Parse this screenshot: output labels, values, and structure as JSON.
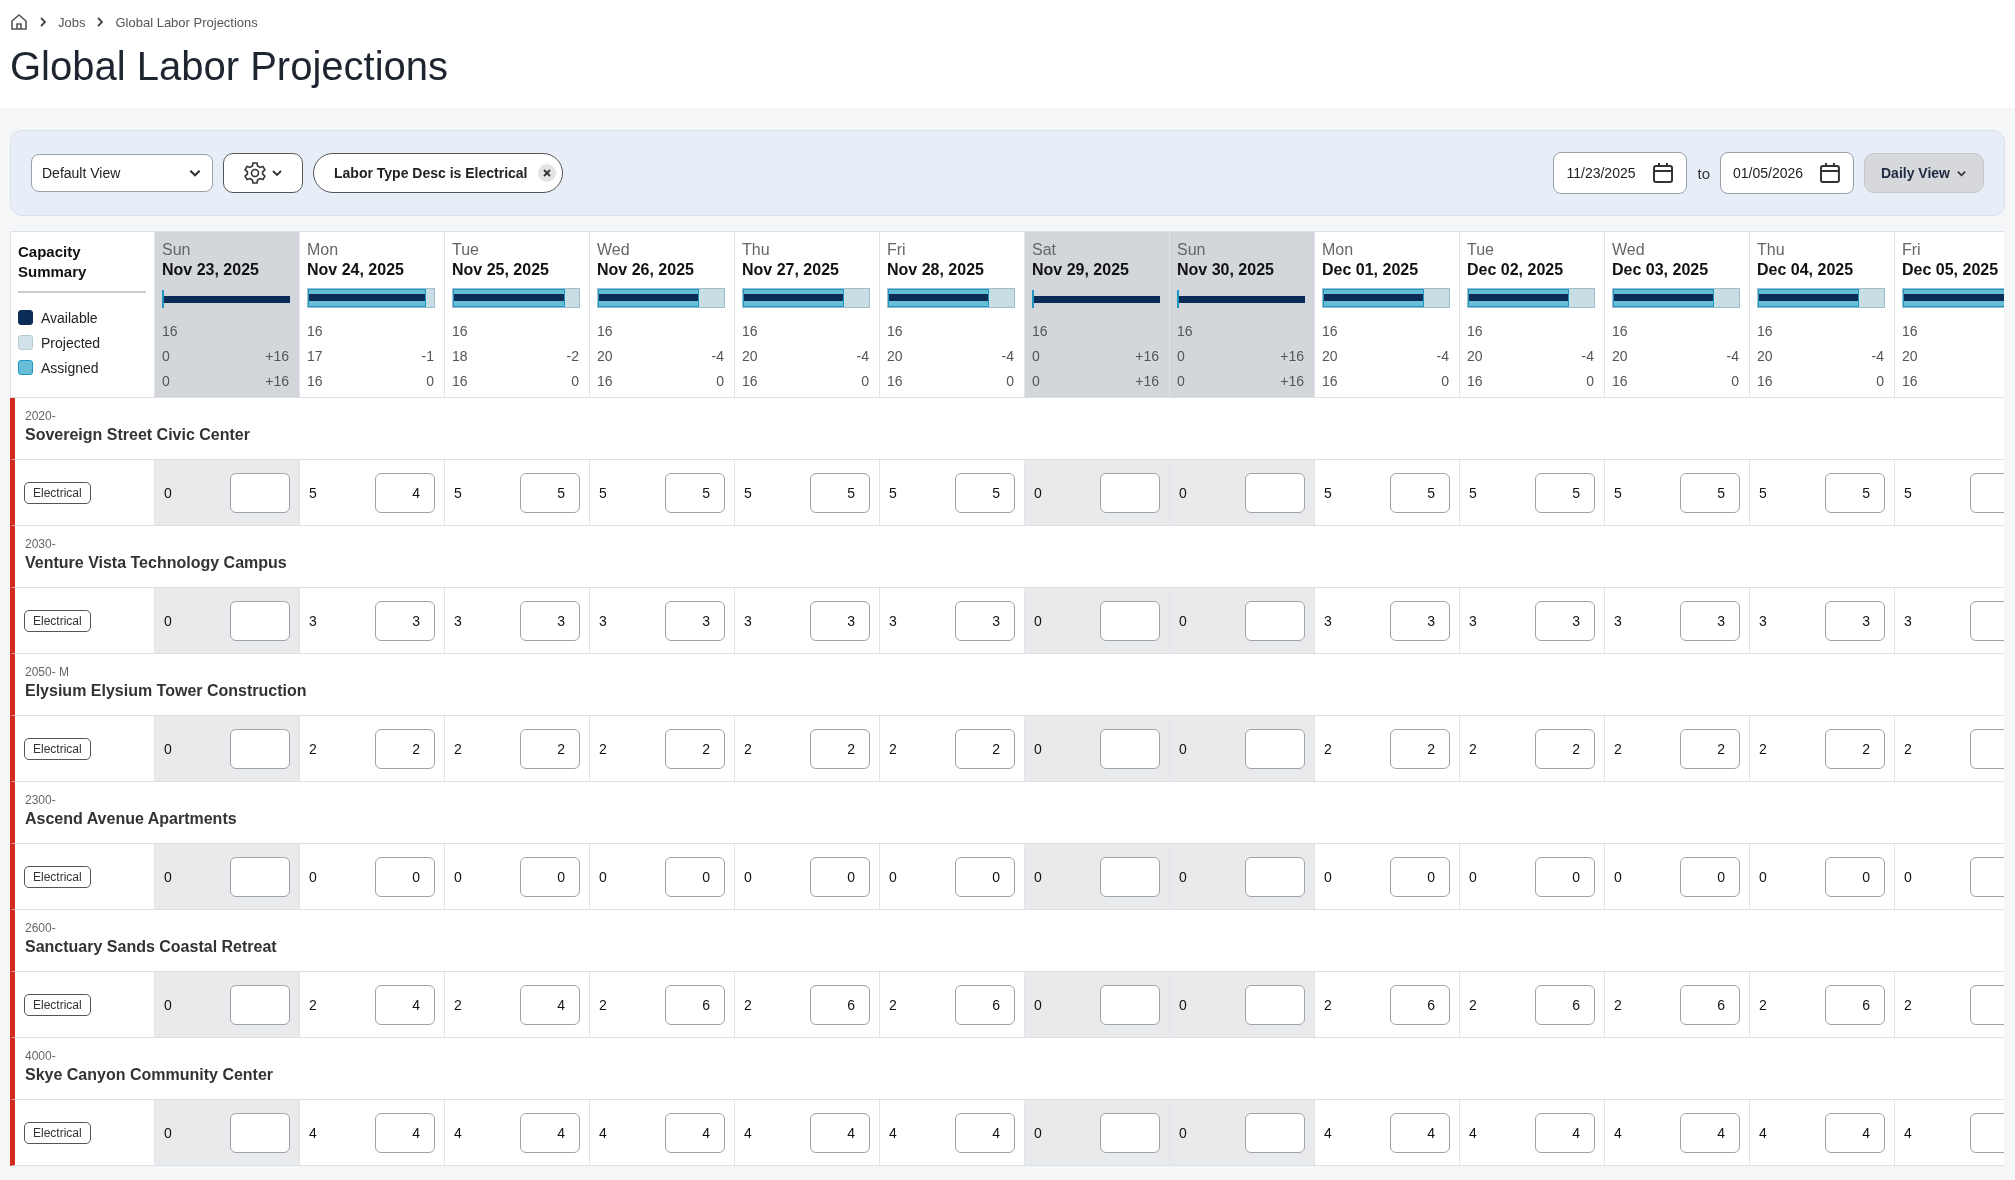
{
  "breadcrumb": [
    "Jobs",
    "Global Labor Projections"
  ],
  "title": "Global Labor Projections",
  "toolbar": {
    "view": "Default View",
    "filter_chip": "Labor Type Desc is Electrical",
    "date_from": "11/23/2025",
    "to_label": "to",
    "date_to": "01/05/2026",
    "range_view": "Daily View"
  },
  "summary": {
    "title": "Capacity Summary",
    "legend": [
      "Available",
      "Projected",
      "Assigned"
    ]
  },
  "days": [
    {
      "weekday": "Sun",
      "date": "Nov 23, 2025",
      "shaded": true,
      "level": 0,
      "available": "16",
      "projected": "0",
      "projected_diff": "+16",
      "assigned": "0",
      "assigned_diff": "+16"
    },
    {
      "weekday": "Mon",
      "date": "Nov 24, 2025",
      "shaded": false,
      "level": 0.94,
      "available": "16",
      "projected": "17",
      "projected_diff": "-1",
      "assigned": "16",
      "assigned_diff": "0"
    },
    {
      "weekday": "Tue",
      "date": "Nov 25, 2025",
      "shaded": false,
      "level": 0.89,
      "available": "16",
      "projected": "18",
      "projected_diff": "-2",
      "assigned": "16",
      "assigned_diff": "0"
    },
    {
      "weekday": "Wed",
      "date": "Nov 26, 2025",
      "shaded": false,
      "level": 0.8,
      "available": "16",
      "projected": "20",
      "projected_diff": "-4",
      "assigned": "16",
      "assigned_diff": "0"
    },
    {
      "weekday": "Thu",
      "date": "Nov 27, 2025",
      "shaded": false,
      "level": 0.8,
      "available": "16",
      "projected": "20",
      "projected_diff": "-4",
      "assigned": "16",
      "assigned_diff": "0"
    },
    {
      "weekday": "Fri",
      "date": "Nov 28, 2025",
      "shaded": false,
      "level": 0.8,
      "available": "16",
      "projected": "20",
      "projected_diff": "-4",
      "assigned": "16",
      "assigned_diff": "0"
    },
    {
      "weekday": "Sat",
      "date": "Nov 29, 2025",
      "shaded": true,
      "level": 0,
      "available": "16",
      "projected": "0",
      "projected_diff": "+16",
      "assigned": "0",
      "assigned_diff": "+16"
    },
    {
      "weekday": "Sun",
      "date": "Nov 30, 2025",
      "shaded": true,
      "level": 0,
      "available": "16",
      "projected": "0",
      "projected_diff": "+16",
      "assigned": "0",
      "assigned_diff": "+16"
    },
    {
      "weekday": "Mon",
      "date": "Dec 01, 2025",
      "shaded": false,
      "level": 0.8,
      "available": "16",
      "projected": "20",
      "projected_diff": "-4",
      "assigned": "16",
      "assigned_diff": "0"
    },
    {
      "weekday": "Tue",
      "date": "Dec 02, 2025",
      "shaded": false,
      "level": 0.8,
      "available": "16",
      "projected": "20",
      "projected_diff": "-4",
      "assigned": "16",
      "assigned_diff": "0"
    },
    {
      "weekday": "Wed",
      "date": "Dec 03, 2025",
      "shaded": false,
      "level": 0.8,
      "available": "16",
      "projected": "20",
      "projected_diff": "-4",
      "assigned": "16",
      "assigned_diff": "0"
    },
    {
      "weekday": "Thu",
      "date": "Dec 04, 2025",
      "shaded": false,
      "level": 0.8,
      "available": "16",
      "projected": "20",
      "projected_diff": "-4",
      "assigned": "16",
      "assigned_diff": "0"
    },
    {
      "weekday": "Fri",
      "date": "Dec 05, 2025",
      "shaded": false,
      "available": "16",
      "projected": "20",
      "assigned": "16"
    }
  ],
  "jobs": [
    {
      "code": "2020-",
      "name": "Sovereign Street Civic Center",
      "labor_type": "Electrical",
      "cells": [
        {
          "hours": "0"
        },
        {
          "hours": "5",
          "input": "4"
        },
        {
          "hours": "5",
          "input": "5"
        },
        {
          "hours": "5",
          "input": "5"
        },
        {
          "hours": "5",
          "input": "5"
        },
        {
          "hours": "5",
          "input": "5"
        },
        {
          "hours": "0"
        },
        {
          "hours": "0"
        },
        {
          "hours": "5",
          "input": "5"
        },
        {
          "hours": "5",
          "input": "5"
        },
        {
          "hours": "5",
          "input": "5"
        },
        {
          "hours": "5",
          "input": "5"
        },
        {
          "hours": "5"
        }
      ]
    },
    {
      "code": "2030-",
      "name": "Venture Vista Technology Campus",
      "labor_type": "Electrical",
      "cells": [
        {
          "hours": "0"
        },
        {
          "hours": "3",
          "input": "3"
        },
        {
          "hours": "3",
          "input": "3"
        },
        {
          "hours": "3",
          "input": "3"
        },
        {
          "hours": "3",
          "input": "3"
        },
        {
          "hours": "3",
          "input": "3"
        },
        {
          "hours": "0"
        },
        {
          "hours": "0"
        },
        {
          "hours": "3",
          "input": "3"
        },
        {
          "hours": "3",
          "input": "3"
        },
        {
          "hours": "3",
          "input": "3"
        },
        {
          "hours": "3",
          "input": "3"
        },
        {
          "hours": "3"
        }
      ]
    },
    {
      "code": "2050- M",
      "name": "Elysium Elysium Tower Construction",
      "labor_type": "Electrical",
      "cells": [
        {
          "hours": "0"
        },
        {
          "hours": "2",
          "input": "2"
        },
        {
          "hours": "2",
          "input": "2"
        },
        {
          "hours": "2",
          "input": "2"
        },
        {
          "hours": "2",
          "input": "2"
        },
        {
          "hours": "2",
          "input": "2"
        },
        {
          "hours": "0"
        },
        {
          "hours": "0"
        },
        {
          "hours": "2",
          "input": "2"
        },
        {
          "hours": "2",
          "input": "2"
        },
        {
          "hours": "2",
          "input": "2"
        },
        {
          "hours": "2",
          "input": "2"
        },
        {
          "hours": "2"
        }
      ]
    },
    {
      "code": "2300-",
      "name": "Ascend Avenue Apartments",
      "labor_type": "Electrical",
      "cells": [
        {
          "hours": "0"
        },
        {
          "hours": "0",
          "input": "0"
        },
        {
          "hours": "0",
          "input": "0"
        },
        {
          "hours": "0",
          "input": "0"
        },
        {
          "hours": "0",
          "input": "0"
        },
        {
          "hours": "0",
          "input": "0"
        },
        {
          "hours": "0"
        },
        {
          "hours": "0"
        },
        {
          "hours": "0",
          "input": "0"
        },
        {
          "hours": "0",
          "input": "0"
        },
        {
          "hours": "0",
          "input": "0"
        },
        {
          "hours": "0",
          "input": "0"
        },
        {
          "hours": "0"
        }
      ]
    },
    {
      "code": "2600-",
      "name": "Sanctuary Sands Coastal Retreat",
      "labor_type": "Electrical",
      "cells": [
        {
          "hours": "0"
        },
        {
          "hours": "2",
          "input": "4"
        },
        {
          "hours": "2",
          "input": "4"
        },
        {
          "hours": "2",
          "input": "6"
        },
        {
          "hours": "2",
          "input": "6"
        },
        {
          "hours": "2",
          "input": "6"
        },
        {
          "hours": "0"
        },
        {
          "hours": "0"
        },
        {
          "hours": "2",
          "input": "6"
        },
        {
          "hours": "2",
          "input": "6"
        },
        {
          "hours": "2",
          "input": "6"
        },
        {
          "hours": "2",
          "input": "6"
        },
        {
          "hours": "2"
        }
      ]
    },
    {
      "code": "4000-",
      "name": "Skye Canyon Community Center",
      "labor_type": "Electrical",
      "cells": [
        {
          "hours": "0"
        },
        {
          "hours": "4",
          "input": "4"
        },
        {
          "hours": "4",
          "input": "4"
        },
        {
          "hours": "4",
          "input": "4"
        },
        {
          "hours": "4",
          "input": "4"
        },
        {
          "hours": "4",
          "input": "4"
        },
        {
          "hours": "0"
        },
        {
          "hours": "0"
        },
        {
          "hours": "4",
          "input": "4"
        },
        {
          "hours": "4",
          "input": "4"
        },
        {
          "hours": "4",
          "input": "4"
        },
        {
          "hours": "4",
          "input": "4"
        },
        {
          "hours": "4"
        }
      ]
    }
  ]
}
